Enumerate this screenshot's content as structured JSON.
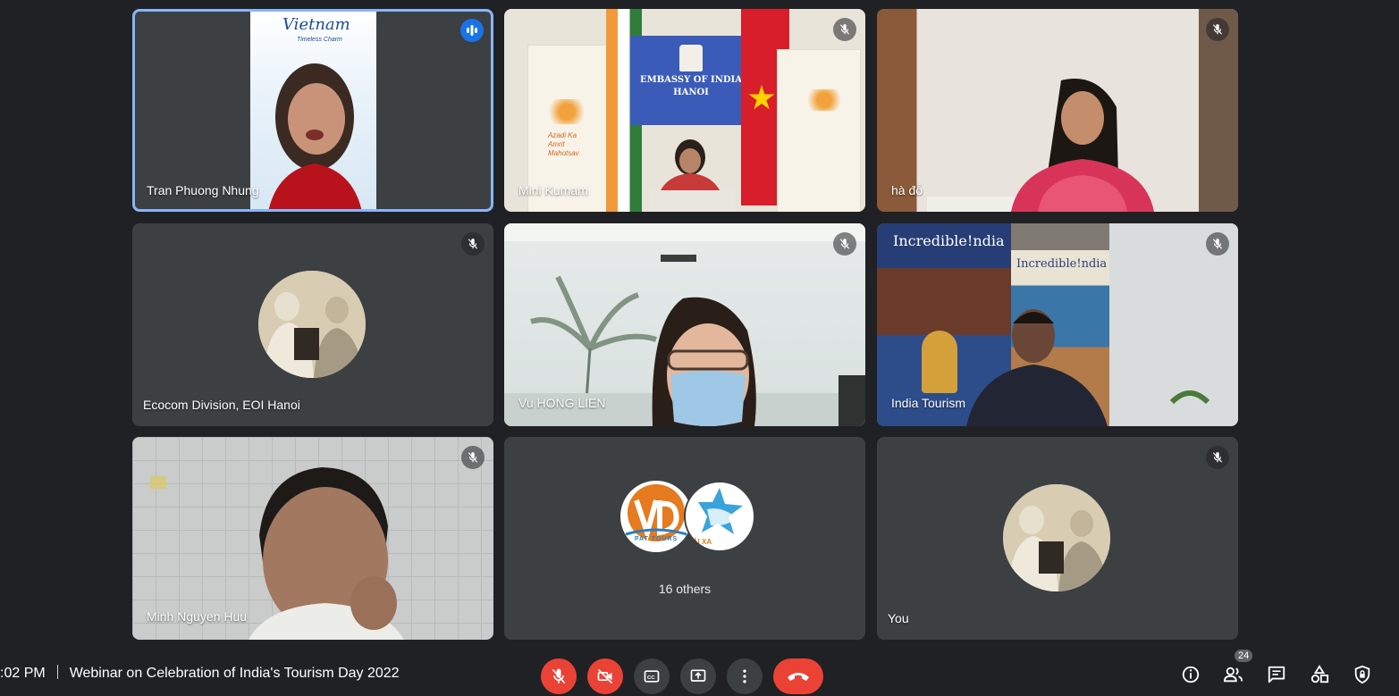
{
  "tiles": [
    {
      "name": "Tran Phuong Nhung",
      "backdrop_brand": "Vietnam",
      "backdrop_tagline": "Timeless Charm",
      "status": "speaking"
    },
    {
      "name": "Mini Kumam",
      "sign_line1": "EMBASSY OF INDIA",
      "sign_line2": "HANOI",
      "banner_text": "Azadi Ka Amrit Mahotsav",
      "status": "muted"
    },
    {
      "name": "hà đỗ",
      "status": "muted"
    },
    {
      "name": "Ecocom Division, EOI Hanoi",
      "status": "muted"
    },
    {
      "name": "Vu HONG LIEN",
      "status": "muted"
    },
    {
      "name": "India Tourism",
      "poster_text": "Incredible!ndia",
      "status": "muted"
    },
    {
      "name": "Minh Nguyen Huu",
      "status": "muted"
    },
    {
      "others_label": "16 others",
      "logo_text": "PAT TOURS",
      "logo2_text": "HẢI XA"
    },
    {
      "name": "You",
      "status": "muted"
    }
  ],
  "meeting": {
    "time": ":02 PM",
    "title": "Webinar on Celebration of India's Tourism Day 2022"
  },
  "controls": {
    "mic": "mic-off-icon",
    "camera": "camera-off-icon",
    "captions": "captions-icon",
    "present": "present-icon",
    "more": "more-vert-icon",
    "end_call": "end-call-icon"
  },
  "right_controls": {
    "participants_count": "24"
  },
  "colors": {
    "background": "#202124",
    "tile": "#3c4043",
    "active_border": "#8ab4f8",
    "red": "#ea4335",
    "speaking": "#1a73e8"
  }
}
